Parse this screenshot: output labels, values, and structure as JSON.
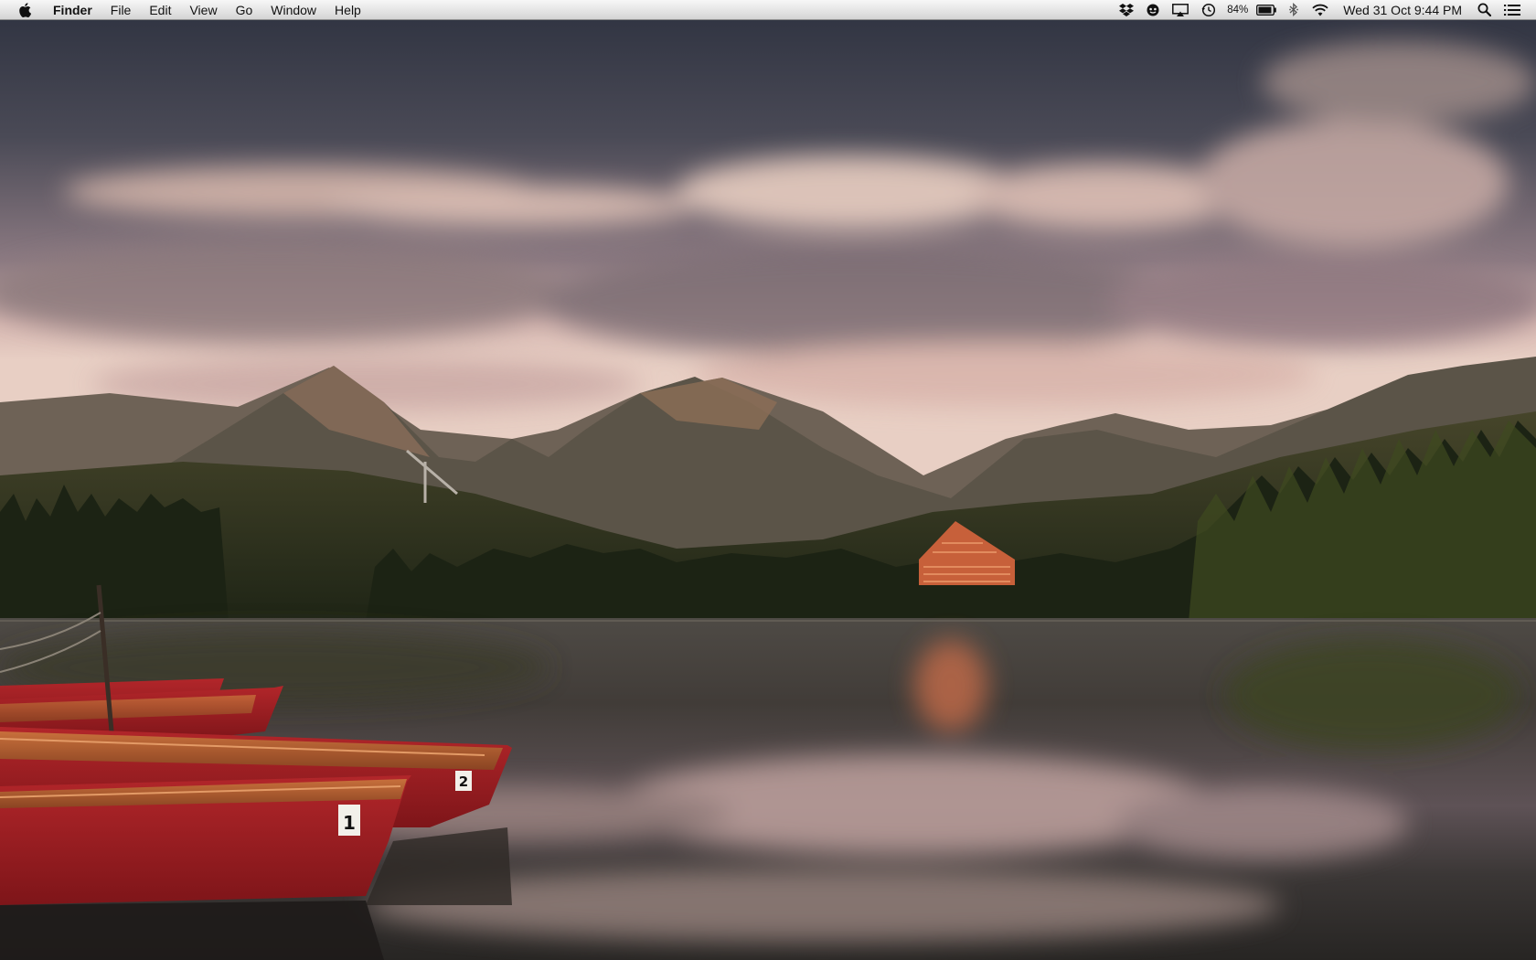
{
  "menubar": {
    "app_name": "Finder",
    "items": [
      "File",
      "Edit",
      "View",
      "Go",
      "Window",
      "Help"
    ],
    "status": {
      "icons": [
        "dropbox-icon",
        "sync-icon",
        "airplay-icon",
        "time-machine-icon",
        "battery-icon",
        "bluetooth-icon",
        "wifi-icon",
        "spotlight-icon",
        "notification-center-icon"
      ],
      "battery_percent": "84%",
      "clock": "Wed 31 Oct  9:44 PM"
    }
  },
  "wallpaper": {
    "boat_numbers": [
      "1",
      "2"
    ]
  }
}
